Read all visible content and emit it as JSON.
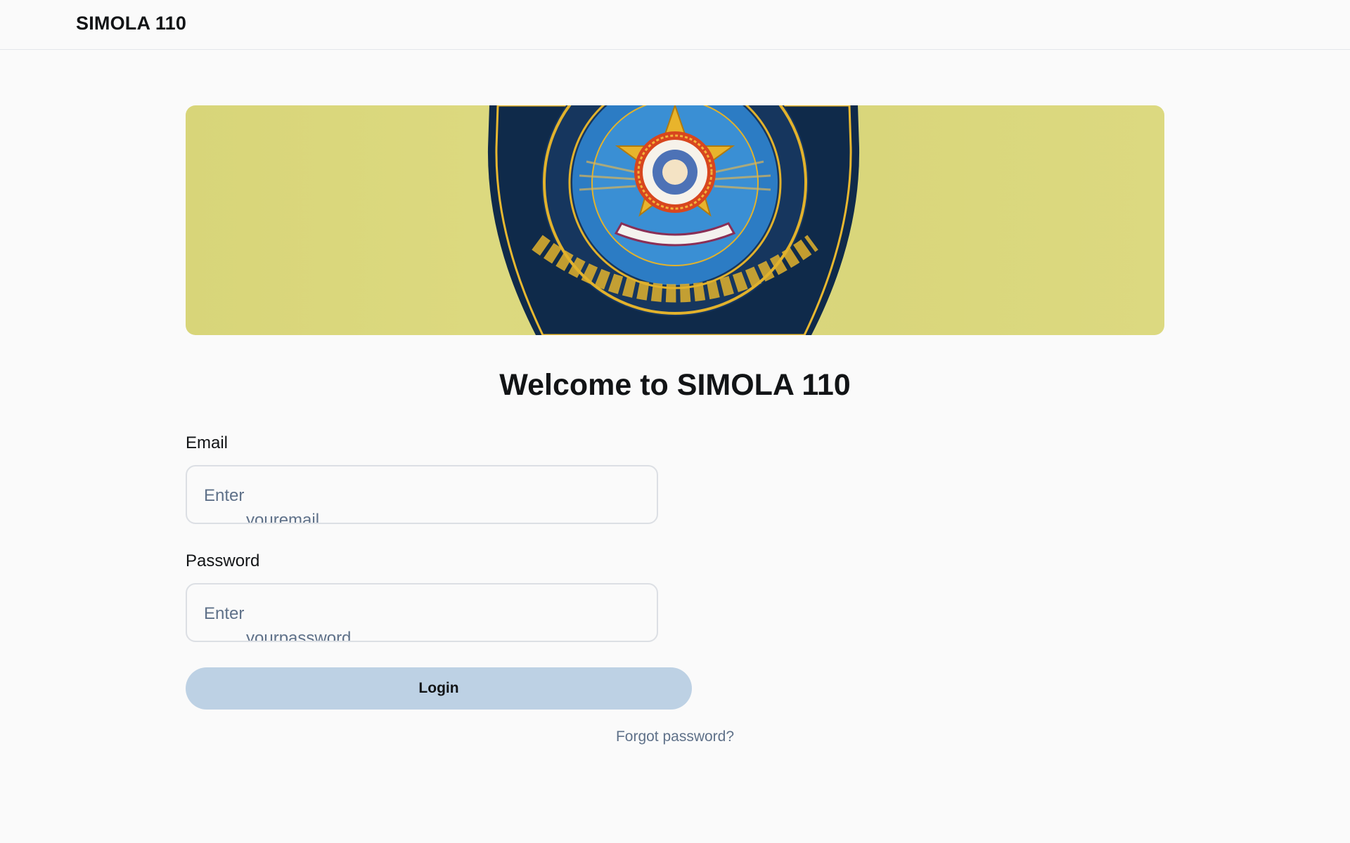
{
  "header": {
    "brand": "SIMOLA 110"
  },
  "banner": {
    "image": "police-badge-emblem",
    "background_color": "#d9d67b"
  },
  "main": {
    "title": "Welcome to SIMOLA 110",
    "email": {
      "label": "Email",
      "placeholder_line1": "Enter",
      "placeholder_line2": "youremail",
      "value": ""
    },
    "password": {
      "label": "Password",
      "placeholder_line1": "Enter",
      "placeholder_line2": "yourpassword",
      "value": ""
    },
    "login_label": "Login",
    "forgot_label": "Forgot password?"
  },
  "colors": {
    "accent_button": "#bdd1e4",
    "muted_text": "#5f7189",
    "text": "#121416"
  }
}
